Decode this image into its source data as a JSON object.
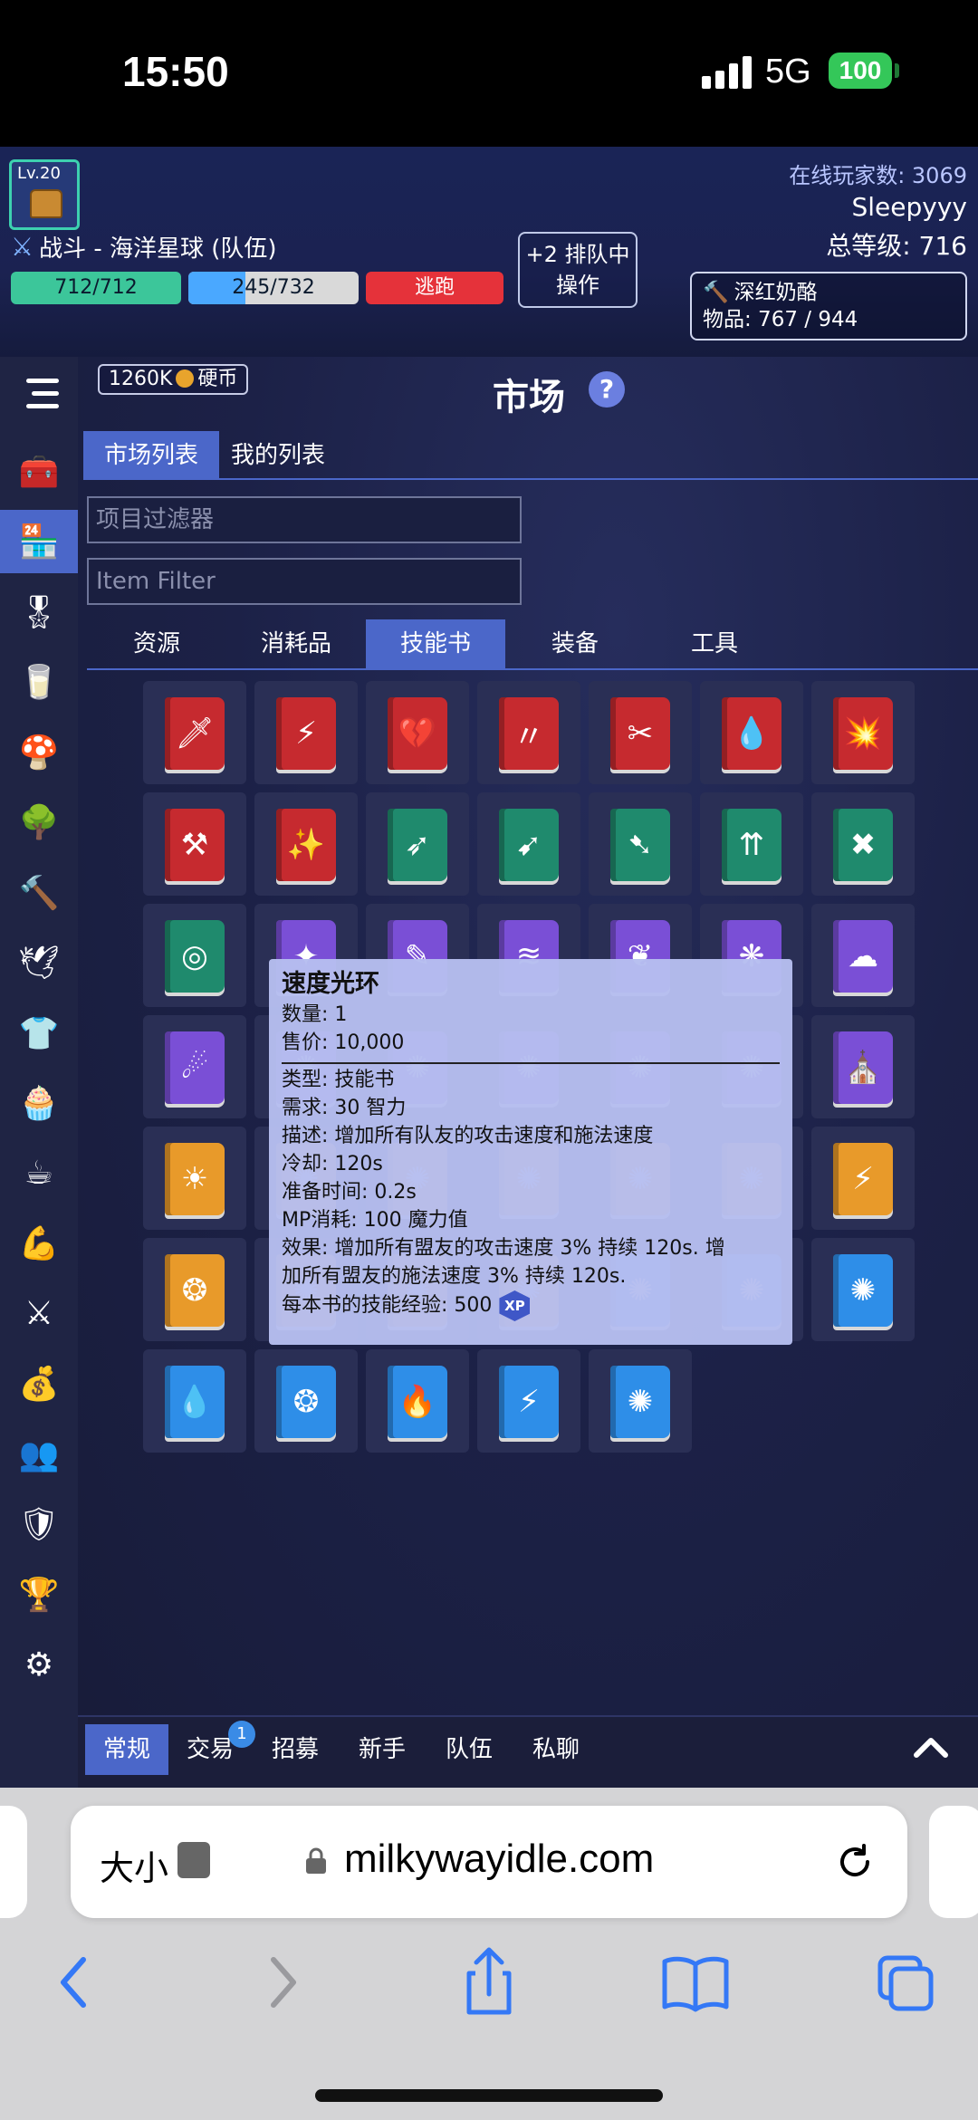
{
  "status_bar": {
    "time": "15:50",
    "network": "5G",
    "battery": "100"
  },
  "header": {
    "level": "Lv.20",
    "action": "战斗 - 海洋星球 (队伍)",
    "hp": "712/712",
    "mp": "245/732",
    "mp_fraction": 0.335,
    "flee": "逃跑",
    "queue_line1": "+2 排队中",
    "queue_line2": "操作",
    "online_players": "在线玩家数: 3069",
    "username": "Sleepyyy",
    "total_level": "总等级: 716",
    "current_item": "深红奶酪",
    "inventory": "物品: 767 / 944"
  },
  "sidebar": {
    "items": [
      {
        "name": "menu",
        "icon": "menu-icon"
      },
      {
        "name": "inventory",
        "icon": "chest-icon",
        "glyph": "🧰"
      },
      {
        "name": "marketplace",
        "icon": "store-icon",
        "glyph": "🏪",
        "active": true
      },
      {
        "name": "tasks",
        "icon": "banner-icon",
        "glyph": "🎖"
      },
      {
        "name": "milking",
        "icon": "milk-icon",
        "glyph": "🥛"
      },
      {
        "name": "foraging",
        "icon": "mushroom-icon",
        "glyph": "🍄"
      },
      {
        "name": "woodcutting",
        "icon": "tree-icon",
        "glyph": "🌳"
      },
      {
        "name": "cheesesmithing",
        "icon": "hammer-icon",
        "glyph": "🔨"
      },
      {
        "name": "crafting",
        "icon": "origami-icon",
        "glyph": "🕊"
      },
      {
        "name": "tailoring",
        "icon": "shirt-icon",
        "glyph": "👕"
      },
      {
        "name": "cooking",
        "icon": "chef-hat-icon",
        "glyph": "🧁"
      },
      {
        "name": "brewing",
        "icon": "tea-icon",
        "glyph": "☕"
      },
      {
        "name": "enhancing",
        "icon": "arm-icon",
        "glyph": "💪"
      },
      {
        "name": "combat",
        "icon": "swords-icon",
        "glyph": "⚔"
      },
      {
        "name": "shop",
        "icon": "bag-icon",
        "glyph": "💰"
      },
      {
        "name": "social",
        "icon": "people-icon",
        "glyph": "👥"
      },
      {
        "name": "guild",
        "icon": "shield-icon",
        "glyph": "🛡"
      },
      {
        "name": "leaderboard",
        "icon": "trophy-icon",
        "glyph": "🏆"
      },
      {
        "name": "settings",
        "icon": "gear-icon",
        "glyph": "⚙"
      }
    ]
  },
  "market": {
    "coins": "1260K",
    "coins_label": "硬币",
    "title": "市场",
    "help": "?",
    "tabs": [
      "市场列表",
      "我的列表"
    ],
    "filter_placeholder_cn": "项目过滤器",
    "filter_placeholder_en": "Item Filter",
    "categories": [
      "资源",
      "消耗品",
      "技能书",
      "装备",
      "工具"
    ],
    "active_category": 2,
    "books": [
      {
        "color": "red",
        "glyph": "🗡"
      },
      {
        "color": "red",
        "glyph": "⚡"
      },
      {
        "color": "red",
        "glyph": "💔"
      },
      {
        "color": "red",
        "glyph": "〃"
      },
      {
        "color": "red",
        "glyph": "✂"
      },
      {
        "color": "red",
        "glyph": "💧"
      },
      {
        "color": "red",
        "glyph": "💥"
      },
      {
        "color": "red",
        "glyph": "⚒"
      },
      {
        "color": "red",
        "glyph": "✨"
      },
      {
        "color": "green",
        "glyph": "➶"
      },
      {
        "color": "green",
        "glyph": "➹"
      },
      {
        "color": "green",
        "glyph": "➷"
      },
      {
        "color": "green",
        "glyph": "⇈"
      },
      {
        "color": "green",
        "glyph": "✖"
      },
      {
        "color": "green",
        "glyph": "◎"
      },
      {
        "color": "purple",
        "glyph": "✦"
      },
      {
        "color": "purple",
        "glyph": "✎"
      },
      {
        "color": "purple",
        "glyph": "≋"
      },
      {
        "color": "purple",
        "glyph": "❦"
      },
      {
        "color": "purple",
        "glyph": "❋"
      },
      {
        "color": "purple",
        "glyph": "☁"
      },
      {
        "color": "purple",
        "glyph": "☄"
      },
      {
        "color": "purple",
        "glyph": "✺"
      },
      {
        "color": "purple",
        "glyph": "✺"
      },
      {
        "color": "purple",
        "glyph": "✺"
      },
      {
        "color": "purple",
        "glyph": "✺"
      },
      {
        "color": "purple",
        "glyph": "✺"
      },
      {
        "color": "purple",
        "glyph": "⛪"
      },
      {
        "color": "orange",
        "glyph": "☀"
      },
      {
        "color": "orange",
        "glyph": "✺"
      },
      {
        "color": "orange",
        "glyph": "✺"
      },
      {
        "color": "orange",
        "glyph": "✺"
      },
      {
        "color": "orange",
        "glyph": "✺"
      },
      {
        "color": "orange",
        "glyph": "✺"
      },
      {
        "color": "orange",
        "glyph": "⚡"
      },
      {
        "color": "orange",
        "glyph": "❂"
      },
      {
        "color": "orange",
        "glyph": "✺"
      },
      {
        "color": "orange",
        "glyph": "✺"
      },
      {
        "color": "orange",
        "glyph": "✺"
      },
      {
        "color": "blue",
        "glyph": "✺"
      },
      {
        "color": "blue",
        "glyph": "✺"
      },
      {
        "color": "blue",
        "glyph": "✺"
      },
      {
        "color": "blue",
        "glyph": "💧"
      },
      {
        "color": "blue",
        "glyph": "❂"
      },
      {
        "color": "blue",
        "glyph": "🔥"
      },
      {
        "color": "blue",
        "glyph": "⚡"
      },
      {
        "color": "blue",
        "glyph": "✺"
      }
    ]
  },
  "tooltip": {
    "title": "速度光环",
    "quantity": "数量: 1",
    "price": "售价: 10,000",
    "type": "类型: 技能书",
    "requirement": "需求: 30 智力",
    "description": "描述: 增加所有队友的攻击速度和施法速度",
    "cooldown": "冷却: 120s",
    "cast_time": "准备时间: 0.2s",
    "mp_cost": "MP消耗: 100 魔力值",
    "effect_line1": "效果: 增加所有盟友的攻击速度 3% 持续 120s. 增",
    "effect_line2": "加所有盟友的施法速度 3% 持续 120s.",
    "xp_per_book": "每本书的技能经验: 500",
    "xp_badge": "XP"
  },
  "chat": {
    "tabs": [
      "常规",
      "交易",
      "招募",
      "新手",
      "队伍",
      "私聊"
    ],
    "trade_badge": "1"
  },
  "browser": {
    "size_label": "大小",
    "url": "milkywayidle.com"
  }
}
